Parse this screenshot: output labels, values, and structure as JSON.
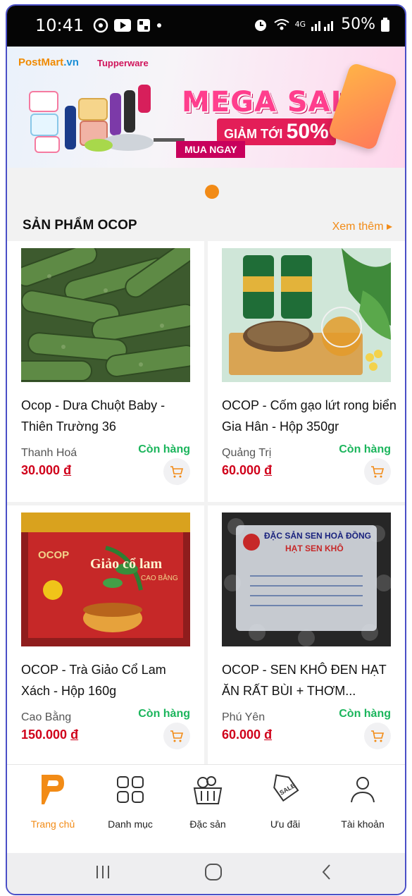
{
  "status_bar": {
    "time": "10:41",
    "network": "4G",
    "battery": "50%"
  },
  "banner": {
    "brand_primary": "PostMart",
    "brand_primary_suffix": ".vn",
    "brand_secondary": "Tupperware",
    "headline": "MEGA SALE",
    "discount_prefix": "GIẢM TỚI",
    "discount_value": "50%",
    "cta": "MUA NGAY"
  },
  "section": {
    "title": "SẢN PHẨM OCOP",
    "see_more": "Xem thêm ▸"
  },
  "products": [
    {
      "name": "Ocop - Dưa Chuột Baby - Thiên Trường 36",
      "origin": "Thanh Hoá",
      "stock": "Còn hàng",
      "price": "30.000",
      "currency": "đ",
      "image_icon": "cucumber-photo"
    },
    {
      "name": "OCOP - Cốm gạo lứt rong biển Gia Hân - Hộp 350gr",
      "origin": "Quảng Trị",
      "stock": "Còn hàng",
      "price": "60.000",
      "currency": "đ",
      "image_icon": "rice-snack-photo"
    },
    {
      "name": "OCOP - Trà Giảo Cổ Lam Xách - Hộp 160g",
      "origin": "Cao Bằng",
      "stock": "Còn hàng",
      "price": "150.000",
      "currency": "đ",
      "image_icon": "tea-box-photo",
      "image_text_1": "OCOP",
      "image_text_2": "Giảo cổ lam",
      "image_text_3": "CAO BẰNG"
    },
    {
      "name": "OCOP - SEN KHÔ ĐEN HẠT ĂN RẤT BÙI + THƠM...",
      "origin": "Phú Yên",
      "stock": "Còn hàng",
      "price": "60.000",
      "currency": "đ",
      "image_icon": "lotus-seed-photo",
      "image_text_1": "ĐẶC SẢN SEN HOÀ ĐỒNG",
      "image_text_2": "HẠT SEN KHÔ"
    }
  ],
  "bottom_nav": [
    {
      "label": "Trang chủ",
      "icon": "home-logo-icon",
      "active": true
    },
    {
      "label": "Danh mục",
      "icon": "grid-icon",
      "active": false
    },
    {
      "label": "Đặc sản",
      "icon": "basket-icon",
      "active": false
    },
    {
      "label": "Ưu đãi",
      "icon": "sale-tag-icon",
      "active": false
    },
    {
      "label": "Tài khoản",
      "icon": "user-icon",
      "active": false
    }
  ],
  "colors": {
    "accent": "#f28b16",
    "price": "#d0021b",
    "in_stock": "#1bb55c"
  }
}
